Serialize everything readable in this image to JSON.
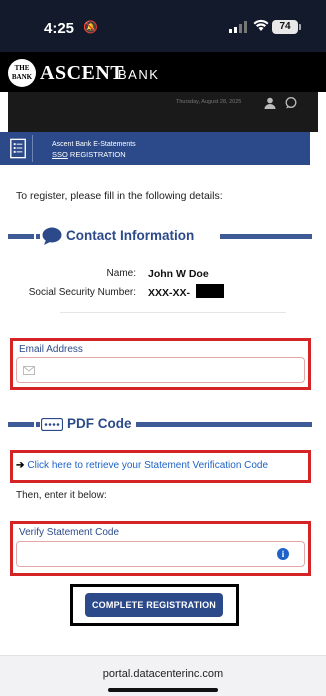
{
  "status_bar": {
    "time": "4:25",
    "battery": "74"
  },
  "header": {
    "logo_text": "THE BANK",
    "brand_name": "ASCENT",
    "brand_suffix": "BANK",
    "date": "Thursday, August 28, 2025"
  },
  "titlebar": {
    "line1": "Ascent Bank E-Statements",
    "line2_prefix": "SSO",
    "line2_suffix": " REGISTRATION"
  },
  "intro": "To register, please fill in the following details:",
  "contact": {
    "heading": "Contact Information",
    "name_label": "Name:",
    "name_value": "John W Doe",
    "ssn_label": "Social Security Number:",
    "ssn_value": "XXX-XX-"
  },
  "email": {
    "label": "Email Address",
    "value": "",
    "placeholder": ""
  },
  "pdf": {
    "heading": "PDF Code",
    "link_text": "Click here to retrieve your Statement Verification Code",
    "instruction": "Then, enter it below:"
  },
  "verify": {
    "label": "Verify Statement Code",
    "value": "",
    "placeholder": ""
  },
  "submit_label": "COMPLETE REGISTRATION",
  "browser": {
    "url": "portal.datacenterinc.com"
  },
  "colors": {
    "brand_blue": "#2c4a8a",
    "highlight_red": "#d42426",
    "link_blue": "#1e62c8"
  },
  "icons": [
    "bell-slash-icon",
    "signal-icon",
    "wifi-icon",
    "battery-icon",
    "user-icon",
    "chat-icon",
    "statement-icon",
    "chat-bubble-icon",
    "keypad-icon",
    "mail-icon",
    "info-icon",
    "arrow-right-icon"
  ]
}
